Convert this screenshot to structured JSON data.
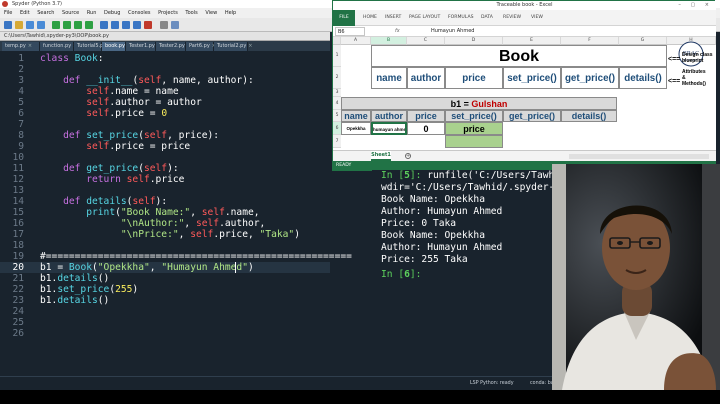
{
  "spyder": {
    "title": "Spyder (Python 3.7)",
    "menus": [
      "File",
      "Edit",
      "Search",
      "Source",
      "Run",
      "Debug",
      "Consoles",
      "Projects",
      "Tools",
      "View",
      "Help"
    ],
    "path": "C:\\Users\\Tawhid\\.spyder-py3\\OOP\\book.py",
    "tabs": [
      {
        "label": "temp.py"
      },
      {
        "label": "function.py"
      },
      {
        "label": "Tutorial5.py"
      },
      {
        "label": "book.py",
        "active": true
      },
      {
        "label": "Tester1.py"
      },
      {
        "label": "Tester2.py"
      },
      {
        "label": "Part6.py"
      },
      {
        "label": "Tutorial2.py"
      }
    ],
    "tab_close_glyph": "×",
    "code": [
      {
        "n": "1",
        "text": "class Book:"
      },
      {
        "n": "2",
        "text": ""
      },
      {
        "n": "3",
        "text": "    def __init__(self, name, author):"
      },
      {
        "n": "4",
        "text": "        self.name = name"
      },
      {
        "n": "5",
        "text": "        self.author = author"
      },
      {
        "n": "6",
        "text": "        self.price = 0"
      },
      {
        "n": "7",
        "text": ""
      },
      {
        "n": "8",
        "text": "    def set_price(self, price):"
      },
      {
        "n": "9",
        "text": "        self.price = price"
      },
      {
        "n": "10",
        "text": ""
      },
      {
        "n": "11",
        "text": "    def get_price(self):"
      },
      {
        "n": "12",
        "text": "        return self.price"
      },
      {
        "n": "13",
        "text": ""
      },
      {
        "n": "14",
        "text": "    def details(self):"
      },
      {
        "n": "15",
        "text": "        print(\"Book Name:\", self.name,"
      },
      {
        "n": "16",
        "text": "              \"\\nAuthor:\", self.author,"
      },
      {
        "n": "17",
        "text": "              \"\\nPrice:\", self.price, \"Taka\")"
      },
      {
        "n": "18",
        "text": ""
      },
      {
        "n": "19",
        "text": "#====================================================="
      },
      {
        "n": "20",
        "text": "b1 = Book(\"Opekkha\", \"Humayun Ahmed\")"
      },
      {
        "n": "21",
        "text": "b1.details()"
      },
      {
        "n": "22",
        "text": "b1.set_price(255)"
      },
      {
        "n": "23",
        "text": "b1.details()"
      },
      {
        "n": "24",
        "text": ""
      },
      {
        "n": "25",
        "text": ""
      },
      {
        "n": "26",
        "text": ""
      }
    ],
    "status": {
      "lsp": "LSP Python: ready",
      "env": "conda: base (Python 3.7.6)",
      "pos": "Line 20, Col 37",
      "enc": "UTF-8",
      "eol": "CRLF",
      "perm": "RW",
      "mem": "Mem 60%",
      "console_tab": "Python console"
    }
  },
  "excel": {
    "title": "Traceable book - Excel",
    "ribbon_tabs": [
      "FILE",
      "HOME",
      "INSERT",
      "PAGE LAYOUT",
      "FORMULAS",
      "DATA",
      "REVIEW",
      "VIEW"
    ],
    "namebox": "B6",
    "fx": "fx",
    "formula": "Humayun Ahmed",
    "columns": [
      "A",
      "B",
      "C",
      "D",
      "E",
      "F",
      "G",
      "H"
    ],
    "rows": [
      "1",
      "2",
      "3",
      "4",
      "5",
      "6",
      "7"
    ],
    "book_title": "Book",
    "class_headers": [
      "name",
      "author",
      "price",
      "set_price()",
      "get_price()",
      "details()"
    ],
    "object_title_prefix": "b1 = ",
    "object_title_name": "Gulshan",
    "object_headers": [
      "name",
      "author",
      "price",
      "set_price()",
      "get_price()",
      "details()"
    ],
    "object_values": {
      "name": "Opekkha",
      "author": "humayun ahmed",
      "price": "0",
      "set_price": "price"
    },
    "logo_text": "BRAC",
    "logo_sub": "UNIVERSITY",
    "arrow_glyph": "<==",
    "notes_top": [
      "Design class",
      "blueprint"
    ],
    "notes_mid": [
      "Attributes",
      "&",
      "Methods()"
    ],
    "sheet": "Sheet1",
    "add_sheet": "+",
    "status": "READY"
  },
  "console": {
    "lines": [
      {
        "prompt": "In [",
        "num": "5",
        "close": "]: ",
        "text": "runfile('C:/Users/Tawh"
      },
      {
        "text": "wdir='C:/Users/Tawhid/.spyder-p"
      },
      {
        "text": "Book Name: Opekkha"
      },
      {
        "text": "Author: Humayun Ahmed"
      },
      {
        "text": "Price: 0 Taka"
      },
      {
        "text": "Book Name: Opekkha"
      },
      {
        "text": "Author: Humayun Ahmed"
      },
      {
        "text": "Price: 255 Taka"
      },
      {
        "text": ""
      },
      {
        "prompt": "In [",
        "num": "6",
        "close": "]: ",
        "text": ""
      }
    ]
  },
  "colors": {
    "editor_bg": "#19232d",
    "keyword": "#c670e0",
    "function": "#57d6e4",
    "string": "#b0e686",
    "number": "#faed5c",
    "excel_green": "#217346",
    "cell_green": "#a9d18e",
    "object_name_red": "#c00000"
  }
}
